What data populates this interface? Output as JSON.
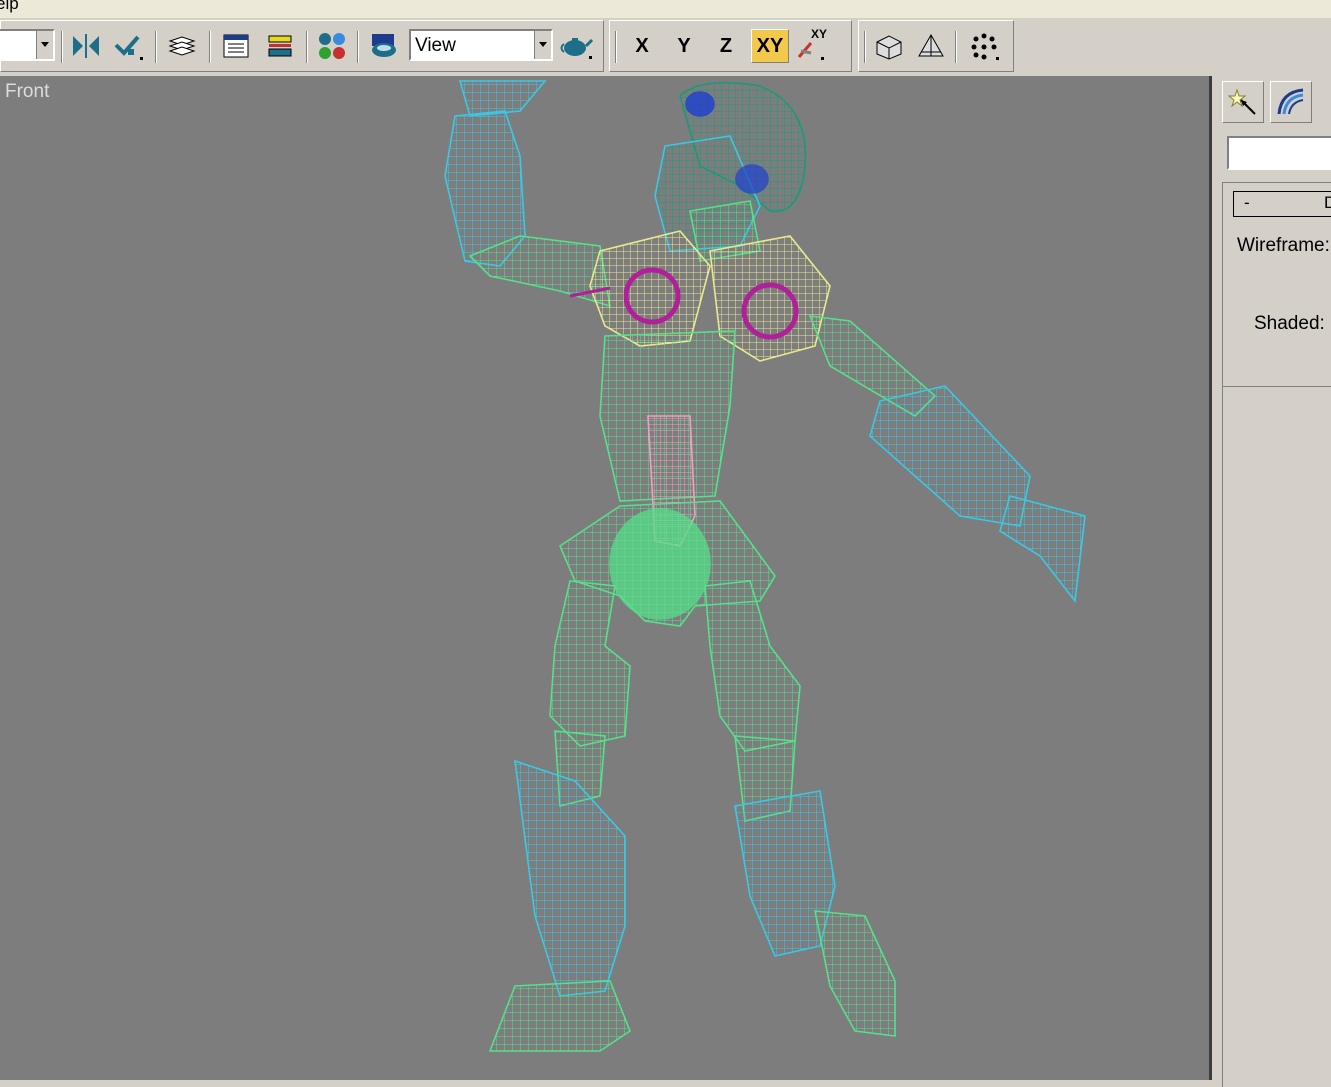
{
  "menubar": {
    "partial_item": "elp"
  },
  "toolbar": {
    "combo_left_value": "",
    "reference_coord": "View",
    "axis_x": "X",
    "axis_y": "Y",
    "axis_z": "Z",
    "axis_xy": "XY",
    "axis_xy_cycle": "XY",
    "active_axis": "XY"
  },
  "viewport": {
    "label": "Front"
  },
  "command_panel": {
    "name_value": "",
    "rollout_toggle": "-",
    "rollout_title": "D",
    "wireframe_label": "Wireframe:",
    "shaded_label": "Shaded:"
  },
  "colors": {
    "viewport_bg": "#7d7d7d",
    "wire_cyan": "#39c8e6",
    "wire_green": "#55e08a",
    "wire_yellow": "#e8e890",
    "wire_magenta": "#b0209a",
    "wire_teal": "#1a9a7a",
    "wire_pink": "#f0a0c0",
    "wire_blue": "#2040d0",
    "active_button": "#f3c94d"
  },
  "icons": [
    "mirror-icon",
    "align-icon",
    "layer-manager-icon",
    "track-view-icon",
    "curve-editor-icon",
    "schematic-view-icon",
    "material-editor-icon",
    "render-teapot-icon",
    "xy-cycle-icon",
    "box-icon",
    "pyramid-icon",
    "array-icon",
    "create-tab-icon",
    "modify-tab-icon"
  ]
}
